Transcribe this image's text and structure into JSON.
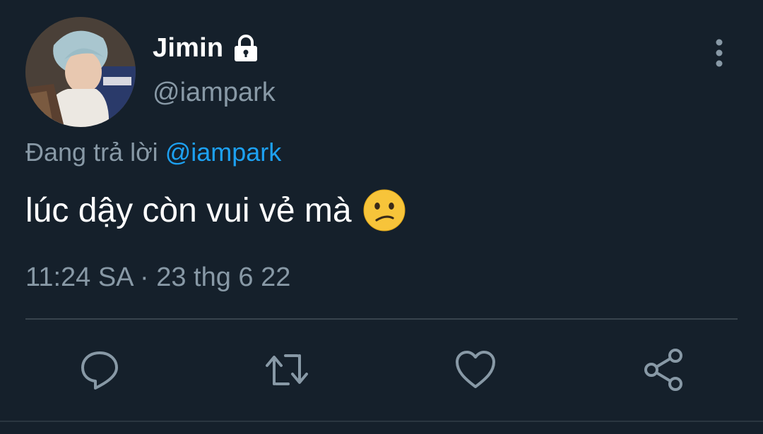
{
  "user": {
    "display_name": "Jimin",
    "handle": "@iampark",
    "locked": true
  },
  "reply": {
    "prefix": "Đang trả lời",
    "mention": "@iampark"
  },
  "tweet": {
    "text": "lúc dậy còn vui vẻ mà",
    "emoji": "confused-face"
  },
  "timestamp": "11:24 SA · 23 thg 6 22",
  "actions": [
    "reply-icon",
    "retweet-icon",
    "like-icon",
    "share-icon"
  ],
  "colors": {
    "background": "#15202b",
    "primary_text": "#ffffff",
    "secondary_text": "#8899a6",
    "link": "#1da1f2",
    "divider": "#38444d"
  }
}
